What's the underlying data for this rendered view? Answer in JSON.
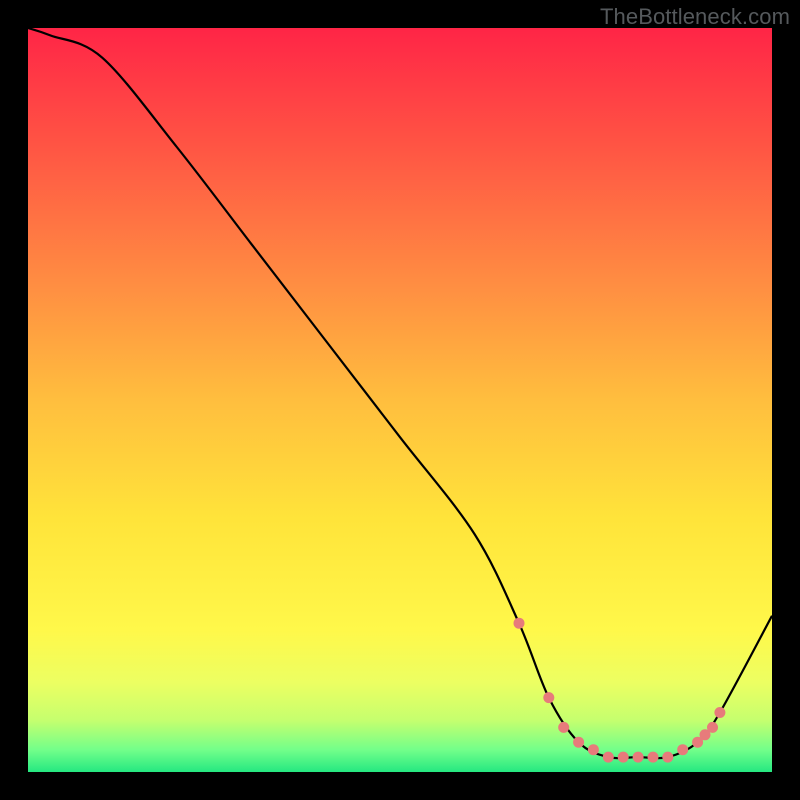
{
  "attribution": "TheBottleneck.com",
  "chart_data": {
    "type": "line",
    "title": "",
    "xlabel": "",
    "ylabel": "",
    "xlim": [
      0,
      100
    ],
    "ylim": [
      0,
      100
    ],
    "x": [
      0,
      3,
      10,
      20,
      30,
      40,
      50,
      60,
      66,
      70,
      74,
      78,
      82,
      86,
      90,
      93,
      100
    ],
    "values": [
      100,
      99,
      96,
      84,
      71,
      58,
      45,
      32,
      20,
      10,
      4,
      2,
      2,
      2,
      4,
      8,
      21
    ],
    "sweet_spot": {
      "x": [
        66,
        70,
        72,
        74,
        76,
        78,
        80,
        82,
        84,
        86,
        88,
        90,
        91,
        92,
        93
      ],
      "values": [
        20,
        10,
        6,
        4,
        3,
        2,
        2,
        2,
        2,
        2,
        3,
        4,
        5,
        6,
        8
      ]
    },
    "annotations": []
  },
  "gradient": {
    "stops": [
      {
        "t": 0.0,
        "c": "#ff2546"
      },
      {
        "t": 0.17,
        "c": "#ff5844"
      },
      {
        "t": 0.34,
        "c": "#ff8c42"
      },
      {
        "t": 0.5,
        "c": "#ffbe3e"
      },
      {
        "t": 0.66,
        "c": "#ffe43a"
      },
      {
        "t": 0.81,
        "c": "#fff84a"
      },
      {
        "t": 0.88,
        "c": "#ecff62"
      },
      {
        "t": 0.93,
        "c": "#c6ff6e"
      },
      {
        "t": 0.97,
        "c": "#73ff8a"
      },
      {
        "t": 1.0,
        "c": "#25e881"
      }
    ]
  }
}
